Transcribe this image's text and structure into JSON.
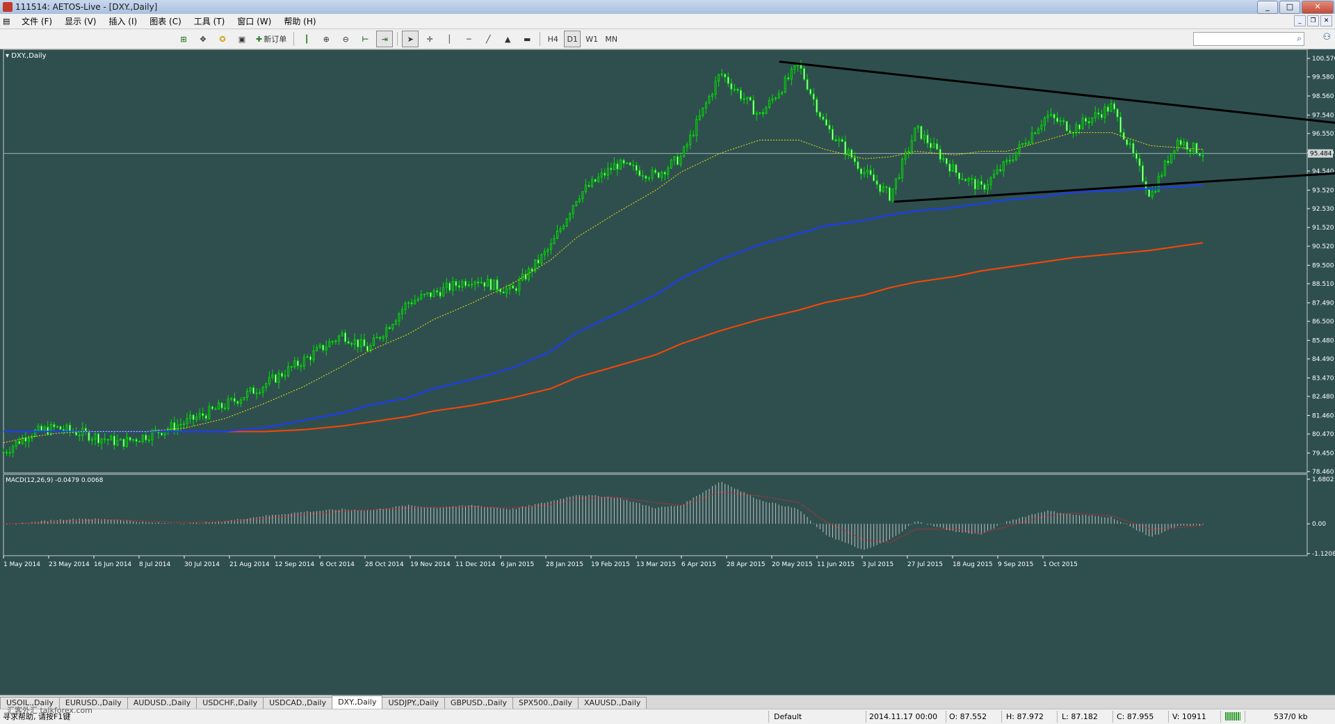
{
  "window": {
    "title": "111514: AETOS-Live - [DXY.,Daily]",
    "controls": [
      "_",
      "□",
      "✕"
    ],
    "mdi_controls": [
      "_",
      "❐",
      "✕"
    ]
  },
  "menu": [
    "文件 (F)",
    "显示 (V)",
    "插入 (I)",
    "图表 (C)",
    "工具 (T)",
    "窗口 (W)",
    "帮助 (H)"
  ],
  "toolbar": {
    "new_order_label": "新订单",
    "timeframes": [
      "H4",
      "D1",
      "W1",
      "MN"
    ],
    "active_timeframe": "D1",
    "search_placeholder": ""
  },
  "chart_data": {
    "type": "candlestick",
    "symbol_label": "DXY.,Daily",
    "ylim": [
      78.46,
      100.57
    ],
    "y_ticks": [
      "100.570",
      "99.580",
      "98.560",
      "97.540",
      "96.550",
      "95.520",
      "94.540",
      "93.520",
      "92.530",
      "91.520",
      "90.520",
      "89.500",
      "88.510",
      "87.490",
      "86.500",
      "85.480",
      "84.490",
      "83.470",
      "82.480",
      "81.460",
      "80.470",
      "79.450",
      "78.460"
    ],
    "current_price": "95.484",
    "x_ticks": [
      "1 May 2014",
      "23 May 2014",
      "16 Jun 2014",
      "8 Jul 2014",
      "30 Jul 2014",
      "21 Aug 2014",
      "12 Sep 2014",
      "6 Oct 2014",
      "28 Oct 2014",
      "19 Nov 2014",
      "11 Dec 2014",
      "6 Jan 2015",
      "28 Jan 2015",
      "19 Feb 2015",
      "13 Mar 2015",
      "6 Apr 2015",
      "28 Apr 2015",
      "20 May 2015",
      "11 Jun 2015",
      "3 Jul 2015",
      "27 Jul 2015",
      "18 Aug 2015",
      "9 Sep 2015",
      "1 Oct 2015"
    ],
    "price_path_x": [
      0,
      0.02,
      0.04,
      0.06,
      0.09,
      0.11,
      0.14,
      0.17,
      0.2,
      0.23,
      0.26,
      0.28,
      0.31,
      0.33,
      0.36,
      0.39,
      0.42,
      0.44,
      0.47,
      0.5,
      0.52,
      0.55,
      0.58,
      0.61,
      0.63,
      0.66,
      0.68,
      0.7,
      0.73,
      0.75,
      0.77,
      0.8,
      0.82,
      0.85,
      0.88,
      0.9,
      0.92
    ],
    "price_path_y": [
      79.5,
      80.5,
      80.8,
      80.5,
      80.0,
      80.4,
      81.1,
      82.0,
      83.1,
      84.4,
      85.8,
      85.0,
      87.5,
      88.0,
      88.8,
      88.1,
      90.5,
      93.2,
      94.9,
      94.3,
      95.3,
      99.8,
      97.5,
      100.2,
      97.0,
      94.5,
      93.2,
      96.8,
      94.5,
      93.6,
      95.0,
      97.5,
      96.8,
      98.0,
      93.2,
      96.2,
      95.5
    ],
    "ma_dotted_yellow": [
      80.0,
      80.3,
      80.5,
      80.6,
      80.6,
      80.6,
      80.8,
      81.3,
      82.1,
      83.0,
      84.1,
      84.9,
      85.8,
      86.6,
      87.5,
      88.5,
      89.8,
      91.0,
      92.3,
      93.5,
      94.5,
      95.5,
      96.2,
      96.2,
      95.7,
      95.2,
      95.3,
      95.6,
      95.4,
      95.6,
      95.6,
      96.2,
      96.6,
      96.6,
      95.9,
      95.8,
      95.7
    ],
    "ma_blue": [
      80.6,
      80.6,
      80.6,
      80.6,
      80.6,
      80.6,
      80.6,
      80.6,
      80.8,
      81.2,
      81.6,
      82.0,
      82.4,
      82.9,
      83.4,
      84.0,
      84.9,
      85.9,
      86.9,
      87.9,
      88.8,
      89.8,
      90.6,
      91.2,
      91.6,
      91.9,
      92.2,
      92.4,
      92.6,
      92.8,
      93.0,
      93.2,
      93.4,
      93.5,
      93.6,
      93.7,
      93.8
    ],
    "ma_orange": [
      80.6,
      80.6,
      80.6,
      80.6,
      80.6,
      80.6,
      80.6,
      80.6,
      80.6,
      80.7,
      80.9,
      81.1,
      81.4,
      81.7,
      82.0,
      82.4,
      82.9,
      83.5,
      84.1,
      84.7,
      85.3,
      86.0,
      86.6,
      87.1,
      87.5,
      87.9,
      88.3,
      88.6,
      88.9,
      89.2,
      89.4,
      89.7,
      89.9,
      90.1,
      90.3,
      90.5,
      90.7
    ],
    "trendlines": [
      {
        "from_x": 0.595,
        "from_y": 100.4,
        "to_x": 1.09,
        "to_y": 96.6
      },
      {
        "from_x": 0.683,
        "from_y": 92.9,
        "to_x": 1.15,
        "to_y": 95.0
      }
    ],
    "macd": {
      "label": "MACD(12,26,9) -0.0479 0.0068",
      "ylim": [
        -1.1208,
        1.6802
      ],
      "y_ticks": [
        "1.6802",
        "0.00",
        "-1.1208"
      ],
      "hist": [
        -0.05,
        0.05,
        0.15,
        0.2,
        0.15,
        0.05,
        0.0,
        0.1,
        0.3,
        0.45,
        0.55,
        0.5,
        0.7,
        0.6,
        0.7,
        0.55,
        0.85,
        1.1,
        1.0,
        0.6,
        0.7,
        1.6,
        0.9,
        0.55,
        -0.4,
        -1.0,
        -0.6,
        0.1,
        -0.3,
        -0.4,
        0.1,
        0.5,
        0.35,
        0.25,
        -0.5,
        -0.1,
        -0.05
      ],
      "signal": [
        0.0,
        0.03,
        0.08,
        0.13,
        0.15,
        0.1,
        0.05,
        0.08,
        0.2,
        0.35,
        0.48,
        0.52,
        0.6,
        0.62,
        0.65,
        0.6,
        0.72,
        0.95,
        1.0,
        0.8,
        0.7,
        1.2,
        1.05,
        0.8,
        0.1,
        -0.6,
        -0.7,
        -0.2,
        -0.2,
        -0.35,
        -0.1,
        0.3,
        0.4,
        0.3,
        -0.2,
        -0.15,
        -0.05
      ]
    }
  },
  "tabs": [
    "USOIL.,Daily",
    "EURUSD.,Daily",
    "AUDUSD.,Daily",
    "USDCHF.,Daily",
    "USDCAD.,Daily",
    "DXY.,Daily",
    "USDJPY.,Daily",
    "GBPUSD.,Daily",
    "SPX500.,Daily",
    "XAUUSD.,Daily"
  ],
  "active_tab": "DXY.,Daily",
  "status": {
    "help": "寻求帮助, 请按F1键",
    "profile": "Default",
    "datetime": "2014.11.17 00:00",
    "open": "O: 87.552",
    "high": "H: 87.972",
    "low": "L: 87.182",
    "close": "C: 87.955",
    "volume": "V: 10911",
    "traffic": "537/0 kb"
  },
  "watermark": "汇客外汇 talkforex.com",
  "colors": {
    "chart_bg": "#2f4f4f",
    "candle": "#00e000",
    "ma_fast": "#e8e800",
    "ma_mid": "#1a3cff",
    "ma_slow": "#ff4500",
    "trendline": "#000000",
    "macd_hist": "#c0c0c0",
    "macd_signal": "#ff2020",
    "axis_text": "#ffffff"
  }
}
